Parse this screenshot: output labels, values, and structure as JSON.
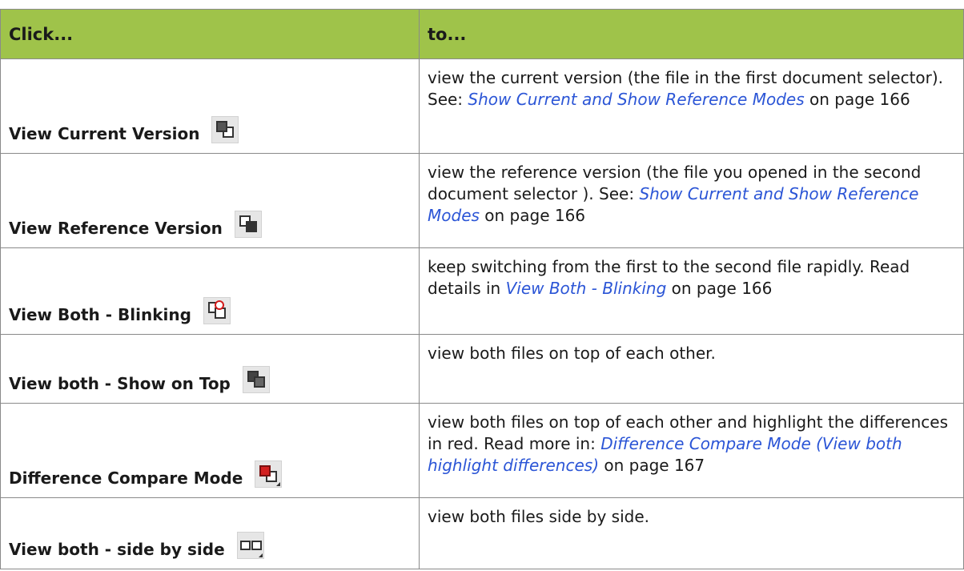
{
  "header": {
    "col1": "Click...",
    "col2": "to..."
  },
  "rows": [
    {
      "click": "View Current Version",
      "icon": "view-current-version-icon",
      "desc_before": "view the current version (the file in the first document selector). See: ",
      "link": "Show Current and Show Reference Modes",
      "desc_after": " on page 166"
    },
    {
      "click": "View Reference Version",
      "icon": "view-reference-version-icon",
      "desc_before": "view the reference version (the file you opened in the second document selector ). See: ",
      "link": "Show Current and Show Reference Modes",
      "desc_after": " on page 166"
    },
    {
      "click": "View Both - Blinking",
      "icon": "view-both-blinking-icon",
      "desc_before": "keep switching from the first to the second file rapidly. Read details in ",
      "link": "View Both - Blinking",
      "desc_after": " on page 166"
    },
    {
      "click": "View both - Show on Top",
      "icon": "view-both-show-on-top-icon",
      "desc_before": "view both files on top of each other."
    },
    {
      "click": "Difference Compare Mode",
      "icon": "difference-compare-mode-icon",
      "desc_before": "view both files on top of each other and highlight the differences in red. Read more in: ",
      "link": "Difference Compare Mode (View both highlight differences)",
      "desc_after": " on page 167"
    },
    {
      "click": "View both - side by side",
      "icon": "view-both-side-by-side-icon",
      "desc_before": "view both files side by side."
    }
  ],
  "colors": {
    "header_bg": "#9fc34a",
    "link": "#2b55d6",
    "border": "#8a8a8a"
  }
}
